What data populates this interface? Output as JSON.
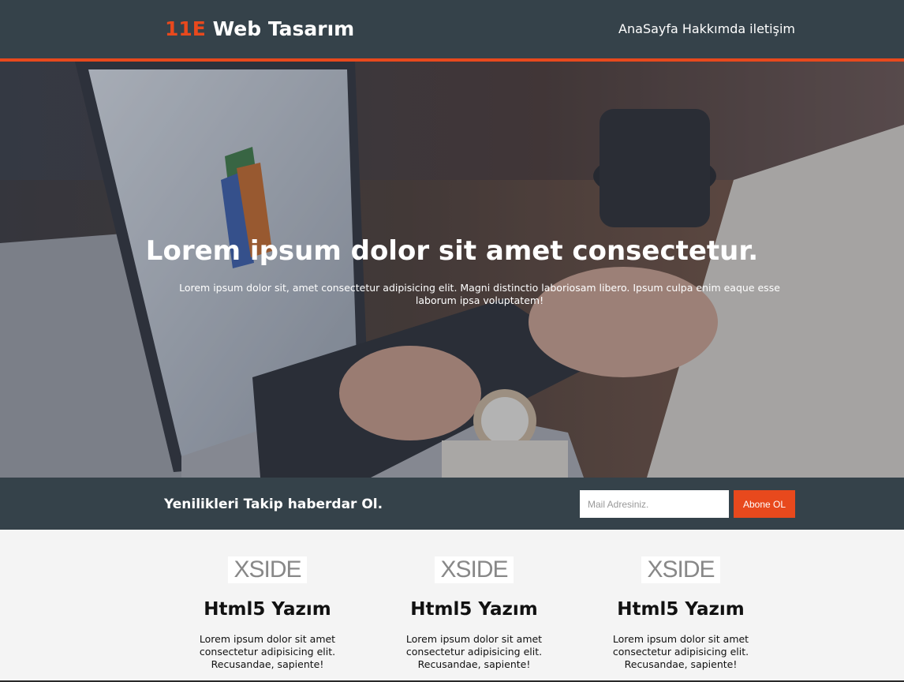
{
  "header": {
    "brand_accent": "11E",
    "brand_rest": " Web Tasarım",
    "nav": [
      "AnaSayfa",
      "Hakkımda",
      "iletişim"
    ]
  },
  "hero": {
    "title": "Lorem ipsum dolor sit amet consectetur.",
    "text": "Lorem ipsum dolor sit, amet consectetur adipisicing elit. Magni distinctio laboriosam libero. Ipsum culpa enim eaque esse laborum ipsa voluptatem!"
  },
  "newsletter": {
    "heading": "Yenilikleri Takip haberdar Ol.",
    "email_placeholder": "Mail Adresiniz.",
    "subscribe_label": "Abone OL"
  },
  "boxes": [
    {
      "logo_text": "XSIDE",
      "title": "Html5 Yazım",
      "text": "Lorem ipsum dolor sit amet consectetur adipisicing elit. Recusandae, sapiente!"
    },
    {
      "logo_text": "XSIDE",
      "title": "Html5 Yazım",
      "text": "Lorem ipsum dolor sit amet consectetur adipisicing elit. Recusandae, sapiente!"
    },
    {
      "logo_text": "XSIDE",
      "title": "Html5 Yazım",
      "text": "Lorem ipsum dolor sit amet consectetur adipisicing elit. Recusandae, sapiente!"
    }
  ],
  "colors": {
    "accent": "#e8491d",
    "dark": "#35424a",
    "light_bg": "#f4f4f4"
  }
}
